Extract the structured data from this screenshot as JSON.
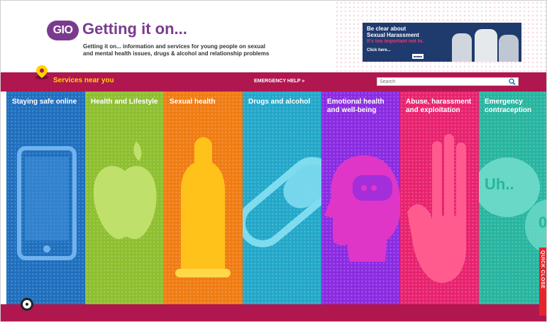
{
  "header": {
    "logo_badge": "GIO",
    "title": "Getting it on...",
    "tagline_line1": "Getting it on... information and services for young people on sexual",
    "tagline_line2": "and mental health issues, drugs & alcohol and relationship problems"
  },
  "banner": {
    "line1": "Be clear about",
    "line2": "Sexual Harassment",
    "line3": "It's too important not to.",
    "cta": "Click here..."
  },
  "nav": {
    "services": "Services near you",
    "emergency": "EMERGENCY HELP »",
    "search_placeholder": "Search"
  },
  "categories": [
    {
      "label": "Staying safe online",
      "color": "#1e6fbe",
      "icon": "phone-icon"
    },
    {
      "label": "Health and Lifestyle",
      "color": "#8dbf2f",
      "icon": "apple-icon"
    },
    {
      "label": "Sexual health",
      "color": "#f07c12",
      "icon": "condom-icon"
    },
    {
      "label": "Drugs and alcohol",
      "color": "#22a7c9",
      "icon": "pill-icon"
    },
    {
      "label": "Emotional health and well-being",
      "color": "#8a2be2",
      "icon": "head-icon"
    },
    {
      "label": "Abuse, harassment and exploitation",
      "color": "#e8226e",
      "icon": "hand-icon"
    },
    {
      "label": "Emergency contraception",
      "color": "#27b5a0",
      "icon": "speech-bubble-icon"
    }
  ],
  "art_text": {
    "uh": "Uh..",
    "zero": "0"
  },
  "quick_close": "QUICK CLOSE",
  "colors": {
    "brand_purple": "#7a3b8f",
    "nav_bar": "#b0174f",
    "services_yellow": "#ffd400"
  }
}
